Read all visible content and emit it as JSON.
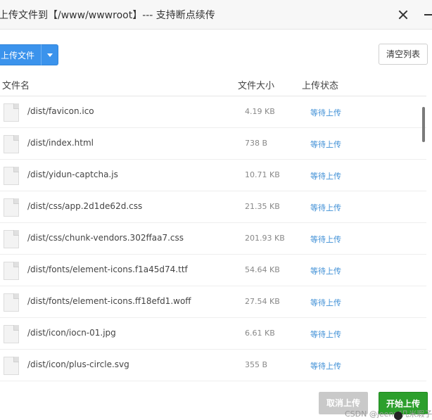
{
  "window": {
    "title": "上传文件到【/www/wwwroot】--- 支持断点续传"
  },
  "toolbar": {
    "upload_label": "上传文件",
    "clear_label": "清空列表"
  },
  "table": {
    "headers": {
      "name": "文件名",
      "size": "文件大小",
      "status": "上传状态"
    },
    "rows": [
      {
        "name": "/dist/favicon.ico",
        "size": "4.19 KB",
        "status": "等待上传"
      },
      {
        "name": "/dist/index.html",
        "size": "738 B",
        "status": "等待上传"
      },
      {
        "name": "/dist/yidun-captcha.js",
        "size": "10.71 KB",
        "status": "等待上传"
      },
      {
        "name": "/dist/css/app.2d1de62d.css",
        "size": "21.35 KB",
        "status": "等待上传"
      },
      {
        "name": "/dist/css/chunk-vendors.302ffaa7.css",
        "size": "201.93 KB",
        "status": "等待上传"
      },
      {
        "name": "/dist/fonts/element-icons.f1a45d74.ttf",
        "size": "54.64 KB",
        "status": "等待上传"
      },
      {
        "name": "/dist/fonts/element-icons.ff18efd1.woff",
        "size": "27.54 KB",
        "status": "等待上传"
      },
      {
        "name": "/dist/icon/iocn-01.jpg",
        "size": "6.61 KB",
        "status": "等待上传"
      },
      {
        "name": "/dist/icon/plus-circle.svg",
        "size": "355 B",
        "status": "等待上传"
      }
    ]
  },
  "footer": {
    "cancel_label": "取消上传",
    "start_label": "开始上传",
    "watermark": "CSDN @jeenpf几米瑕子"
  },
  "colors": {
    "primary": "#3b93ec",
    "start": "#2c9f2c",
    "status_link": "#3f8fd6"
  }
}
